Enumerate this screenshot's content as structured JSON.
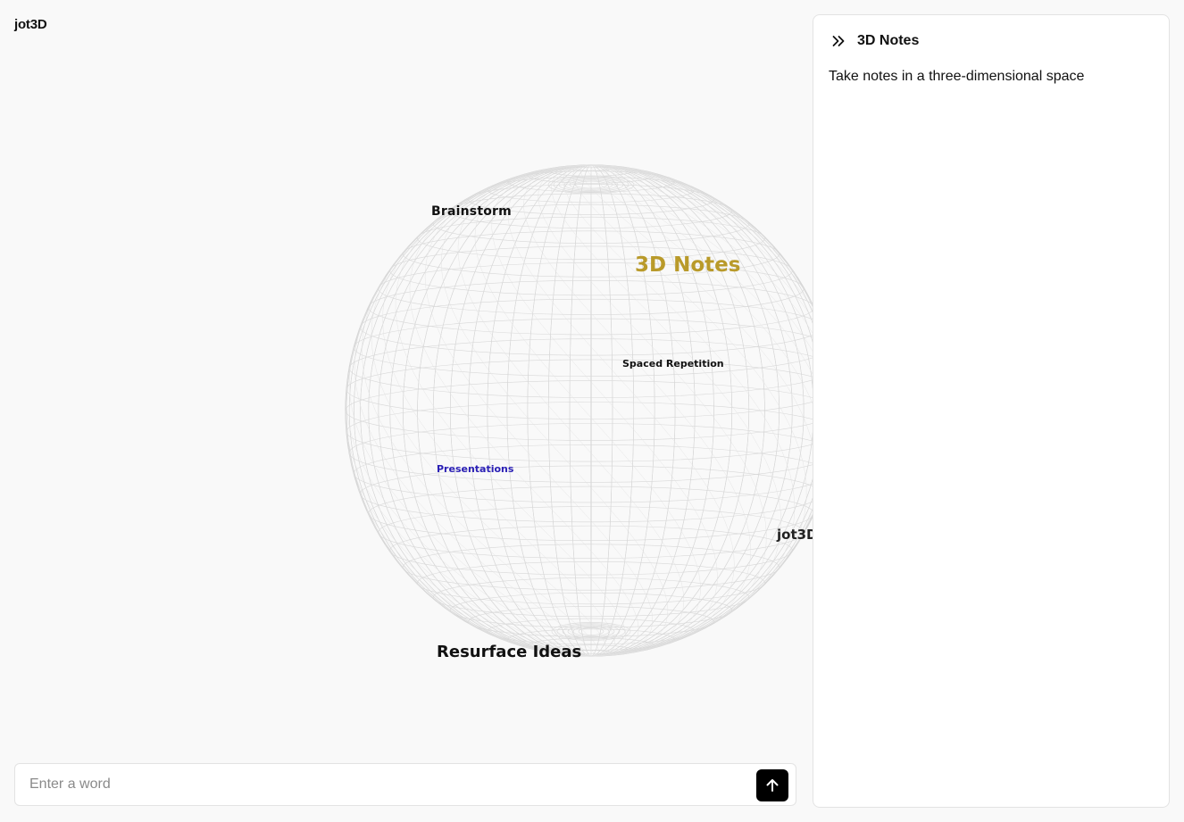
{
  "app": {
    "title": "jot3D"
  },
  "sphere": {
    "words": [
      {
        "text": "Brainstorm",
        "color": "#111111"
      },
      {
        "text": "3D Notes",
        "color": "#b99a2a"
      },
      {
        "text": "Spaced Repetition",
        "color": "#111111"
      },
      {
        "text": "Presentations",
        "color": "#2a1fb5"
      },
      {
        "text": "jot3D",
        "color": "#222222"
      },
      {
        "text": "Resurface Ideas",
        "color": "#111111"
      }
    ]
  },
  "input": {
    "placeholder": "Enter a word",
    "value": "",
    "submit_icon": "arrow-up-icon"
  },
  "panel": {
    "collapse_icon": "chevrons-right-icon",
    "title": "3D Notes",
    "description": "Take notes in a three-dimensional space"
  }
}
